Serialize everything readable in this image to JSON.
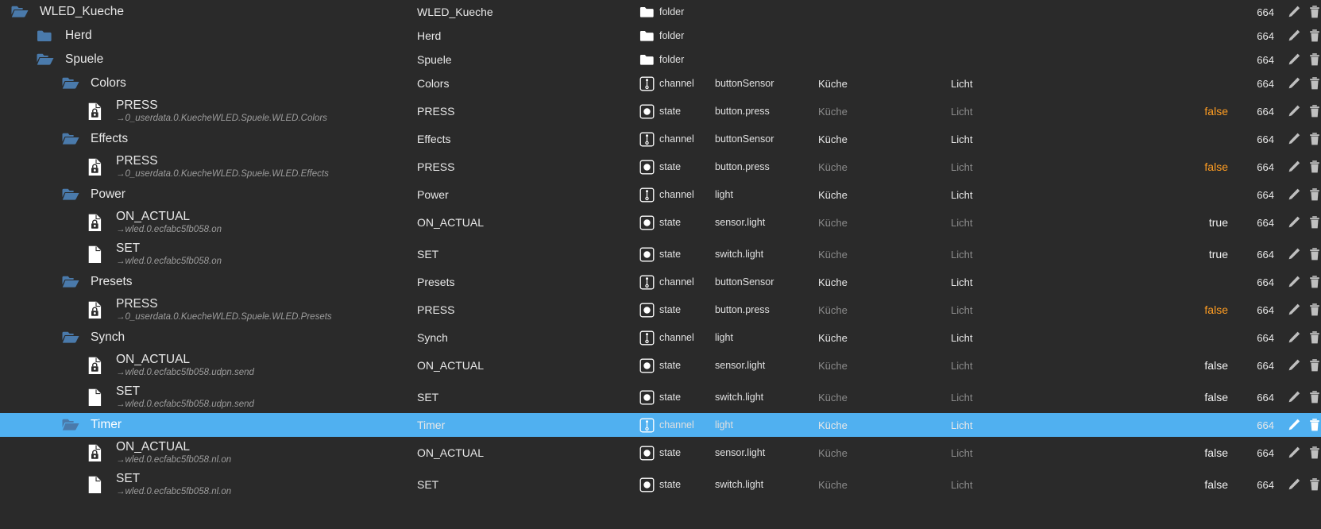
{
  "columns": {
    "tree": "tree-name",
    "name": "name",
    "type": "type",
    "role": "role",
    "room": "room",
    "function": "function",
    "value": "value",
    "count": "count",
    "actions": "actions"
  },
  "colors": {
    "background": "#2a2a2a",
    "selection": "#50b0f0",
    "folder_icon": "#4a7aab",
    "value_orange": "#ff9d22",
    "value_plain": "#f2f2f2",
    "text_primary": "#e8e8e8",
    "text_dim": "#8b8b8b",
    "sub_path": "#9c9c9c",
    "action_icon": "#bfbfbf"
  },
  "icons": {
    "folder_open": "folder-open-icon",
    "folder_closed": "folder-closed-icon",
    "document_locked": "document-locked-icon",
    "document": "document-icon",
    "channel": "channel-icon",
    "state": "state-icon",
    "edit": "pencil-icon",
    "delete": "trash-icon",
    "settings": "gear-icon"
  },
  "rows": [
    {
      "indent": 0,
      "icon": "folder_open",
      "tree_name": "WLED_Kueche",
      "sub": "",
      "name": "WLED_Kueche",
      "type_icon": "folder_closed",
      "type": "folder",
      "role": "",
      "room": "",
      "function": "",
      "room_dim": false,
      "func_dim": false,
      "value": "",
      "value_style": "plain",
      "count": "664",
      "actions": [
        "edit",
        "delete"
      ],
      "selected": false,
      "tall": false
    },
    {
      "indent": 1,
      "icon": "folder_closed",
      "tree_name": "Herd",
      "sub": "",
      "name": "Herd",
      "type_icon": "folder_closed",
      "type": "folder",
      "role": "",
      "room": "",
      "function": "",
      "room_dim": false,
      "func_dim": false,
      "value": "",
      "value_style": "plain",
      "count": "664",
      "actions": [
        "edit",
        "delete"
      ],
      "selected": false,
      "tall": false
    },
    {
      "indent": 1,
      "icon": "folder_open",
      "tree_name": "Spuele",
      "sub": "",
      "name": "Spuele",
      "type_icon": "folder_closed",
      "type": "folder",
      "role": "",
      "room": "",
      "function": "",
      "room_dim": false,
      "func_dim": false,
      "value": "",
      "value_style": "plain",
      "count": "664",
      "actions": [
        "edit",
        "delete"
      ],
      "selected": false,
      "tall": false
    },
    {
      "indent": 2,
      "icon": "folder_open",
      "tree_name": "Colors",
      "sub": "",
      "name": "Colors",
      "type_icon": "channel",
      "type": "channel",
      "role": "buttonSensor",
      "room": "Küche",
      "function": "Licht",
      "room_dim": false,
      "func_dim": false,
      "value": "",
      "value_style": "plain",
      "count": "664",
      "actions": [
        "edit",
        "delete"
      ],
      "selected": false,
      "tall": false
    },
    {
      "indent": 3,
      "icon": "document_locked",
      "tree_name": "PRESS",
      "sub": "→0_userdata.0.KuecheWLED.Spuele.WLED.Colors",
      "name": "PRESS",
      "type_icon": "state",
      "type": "state",
      "role": "button.press",
      "room": "Küche",
      "function": "Licht",
      "room_dim": true,
      "func_dim": true,
      "value": "false",
      "value_style": "orange",
      "count": "664",
      "actions": [
        "edit",
        "delete",
        "settings"
      ],
      "selected": false,
      "tall": true
    },
    {
      "indent": 2,
      "icon": "folder_open",
      "tree_name": "Effects",
      "sub": "",
      "name": "Effects",
      "type_icon": "channel",
      "type": "channel",
      "role": "buttonSensor",
      "room": "Küche",
      "function": "Licht",
      "room_dim": false,
      "func_dim": false,
      "value": "",
      "value_style": "plain",
      "count": "664",
      "actions": [
        "edit",
        "delete"
      ],
      "selected": false,
      "tall": false
    },
    {
      "indent": 3,
      "icon": "document_locked",
      "tree_name": "PRESS",
      "sub": "→0_userdata.0.KuecheWLED.Spuele.WLED.Effects",
      "name": "PRESS",
      "type_icon": "state",
      "type": "state",
      "role": "button.press",
      "room": "Küche",
      "function": "Licht",
      "room_dim": true,
      "func_dim": true,
      "value": "false",
      "value_style": "orange",
      "count": "664",
      "actions": [
        "edit",
        "delete",
        "settings"
      ],
      "selected": false,
      "tall": true
    },
    {
      "indent": 2,
      "icon": "folder_open",
      "tree_name": "Power",
      "sub": "",
      "name": "Power",
      "type_icon": "channel",
      "type": "channel",
      "role": "light",
      "room": "Küche",
      "function": "Licht",
      "room_dim": false,
      "func_dim": false,
      "value": "",
      "value_style": "plain",
      "count": "664",
      "actions": [
        "edit",
        "delete"
      ],
      "selected": false,
      "tall": false
    },
    {
      "indent": 3,
      "icon": "document_locked",
      "tree_name": "ON_ACTUAL",
      "sub": "→wled.0.ecfabc5fb058.on",
      "name": "ON_ACTUAL",
      "type_icon": "state",
      "type": "state",
      "role": "sensor.light",
      "room": "Küche",
      "function": "Licht",
      "room_dim": true,
      "func_dim": true,
      "value": "true",
      "value_style": "plain",
      "count": "664",
      "actions": [
        "edit",
        "delete",
        "settings"
      ],
      "selected": false,
      "tall": true
    },
    {
      "indent": 3,
      "icon": "document",
      "tree_name": "SET",
      "sub": "→wled.0.ecfabc5fb058.on",
      "name": "SET",
      "type_icon": "state",
      "type": "state",
      "role": "switch.light",
      "room": "Küche",
      "function": "Licht",
      "room_dim": true,
      "func_dim": true,
      "value": "true",
      "value_style": "plain",
      "count": "664",
      "actions": [
        "edit",
        "delete",
        "settings"
      ],
      "selected": false,
      "tall": true
    },
    {
      "indent": 2,
      "icon": "folder_open",
      "tree_name": "Presets",
      "sub": "",
      "name": "Presets",
      "type_icon": "channel",
      "type": "channel",
      "role": "buttonSensor",
      "room": "Küche",
      "function": "Licht",
      "room_dim": false,
      "func_dim": false,
      "value": "",
      "value_style": "plain",
      "count": "664",
      "actions": [
        "edit",
        "delete"
      ],
      "selected": false,
      "tall": false
    },
    {
      "indent": 3,
      "icon": "document_locked",
      "tree_name": "PRESS",
      "sub": "→0_userdata.0.KuecheWLED.Spuele.WLED.Presets",
      "name": "PRESS",
      "type_icon": "state",
      "type": "state",
      "role": "button.press",
      "room": "Küche",
      "function": "Licht",
      "room_dim": true,
      "func_dim": true,
      "value": "false",
      "value_style": "orange",
      "count": "664",
      "actions": [
        "edit",
        "delete",
        "settings"
      ],
      "selected": false,
      "tall": true
    },
    {
      "indent": 2,
      "icon": "folder_open",
      "tree_name": "Synch",
      "sub": "",
      "name": "Synch",
      "type_icon": "channel",
      "type": "channel",
      "role": "light",
      "room": "Küche",
      "function": "Licht",
      "room_dim": false,
      "func_dim": false,
      "value": "",
      "value_style": "plain",
      "count": "664",
      "actions": [
        "edit",
        "delete"
      ],
      "selected": false,
      "tall": false
    },
    {
      "indent": 3,
      "icon": "document_locked",
      "tree_name": "ON_ACTUAL",
      "sub": "→wled.0.ecfabc5fb058.udpn.send",
      "name": "ON_ACTUAL",
      "type_icon": "state",
      "type": "state",
      "role": "sensor.light",
      "room": "Küche",
      "function": "Licht",
      "room_dim": true,
      "func_dim": true,
      "value": "false",
      "value_style": "plain",
      "count": "664",
      "actions": [
        "edit",
        "delete",
        "settings"
      ],
      "selected": false,
      "tall": true
    },
    {
      "indent": 3,
      "icon": "document",
      "tree_name": "SET",
      "sub": "→wled.0.ecfabc5fb058.udpn.send",
      "name": "SET",
      "type_icon": "state",
      "type": "state",
      "role": "switch.light",
      "room": "Küche",
      "function": "Licht",
      "room_dim": true,
      "func_dim": true,
      "value": "false",
      "value_style": "plain",
      "count": "664",
      "actions": [
        "edit",
        "delete",
        "settings"
      ],
      "selected": false,
      "tall": true
    },
    {
      "indent": 2,
      "icon": "folder_open",
      "tree_name": "Timer",
      "sub": "",
      "name": "Timer",
      "type_icon": "channel",
      "type": "channel",
      "role": "light",
      "room": "Küche",
      "function": "Licht",
      "room_dim": false,
      "func_dim": false,
      "value": "",
      "value_style": "plain",
      "count": "664",
      "actions": [
        "edit",
        "delete"
      ],
      "selected": true,
      "tall": false
    },
    {
      "indent": 3,
      "icon": "document_locked",
      "tree_name": "ON_ACTUAL",
      "sub": "→wled.0.ecfabc5fb058.nl.on",
      "name": "ON_ACTUAL",
      "type_icon": "state",
      "type": "state",
      "role": "sensor.light",
      "room": "Küche",
      "function": "Licht",
      "room_dim": true,
      "func_dim": true,
      "value": "false",
      "value_style": "plain",
      "count": "664",
      "actions": [
        "edit",
        "delete",
        "settings"
      ],
      "selected": false,
      "tall": true
    },
    {
      "indent": 3,
      "icon": "document",
      "tree_name": "SET",
      "sub": "→wled.0.ecfabc5fb058.nl.on",
      "name": "SET",
      "type_icon": "state",
      "type": "state",
      "role": "switch.light",
      "room": "Küche",
      "function": "Licht",
      "room_dim": true,
      "func_dim": true,
      "value": "false",
      "value_style": "plain",
      "count": "664",
      "actions": [
        "edit",
        "delete",
        "settings"
      ],
      "selected": false,
      "tall": true
    }
  ]
}
